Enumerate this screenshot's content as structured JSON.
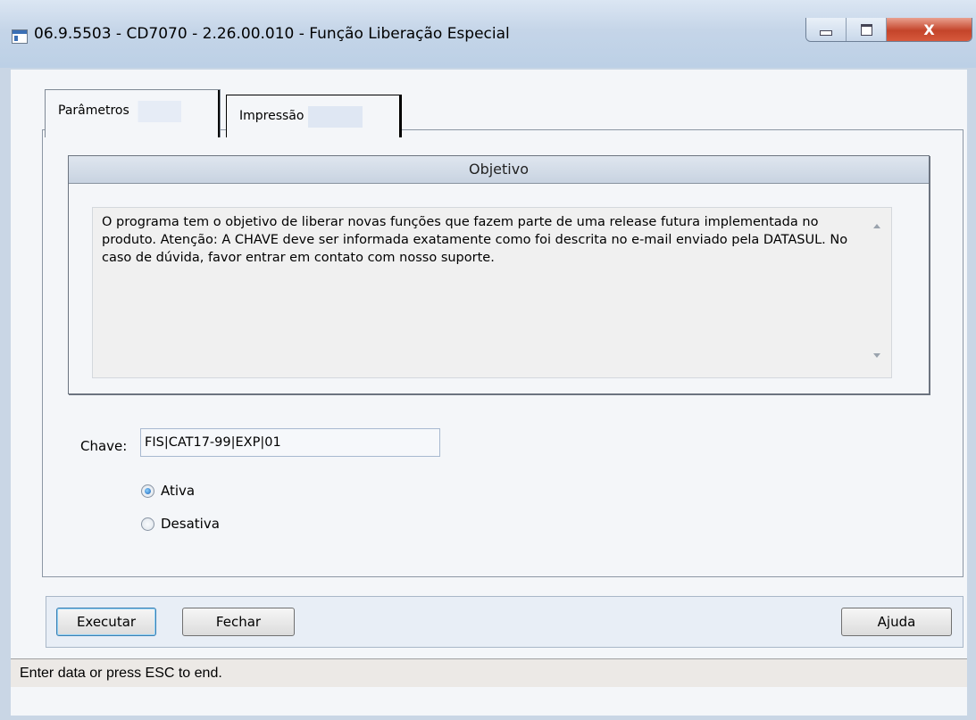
{
  "window": {
    "title": "06.9.5503 - CD7070 - 2.26.00.010 - Função Liberação Especial",
    "close_glyph": "X"
  },
  "tabs": [
    {
      "label": "Parâmetros",
      "active": true
    },
    {
      "label": "Impressão",
      "active": false
    }
  ],
  "objetivo": {
    "header": "Objetivo",
    "text": "O programa tem o objetivo de liberar novas funções que fazem parte de uma release futura implementada no produto. Atenção: A CHAVE deve ser informada exatamente como foi descrita no e-mail enviado pela DATASUL. No caso de dúvida, favor entrar em contato com nosso suporte."
  },
  "chave": {
    "label": "Chave:",
    "value": "FIS|CAT17-99|EXP|01"
  },
  "radios": [
    {
      "label": "Ativa",
      "checked": true
    },
    {
      "label": "Desativa",
      "checked": false
    }
  ],
  "buttons": {
    "executar": "Executar",
    "fechar": "Fechar",
    "ajuda": "Ajuda"
  },
  "status": {
    "text": "Enter data or press ESC to end."
  }
}
